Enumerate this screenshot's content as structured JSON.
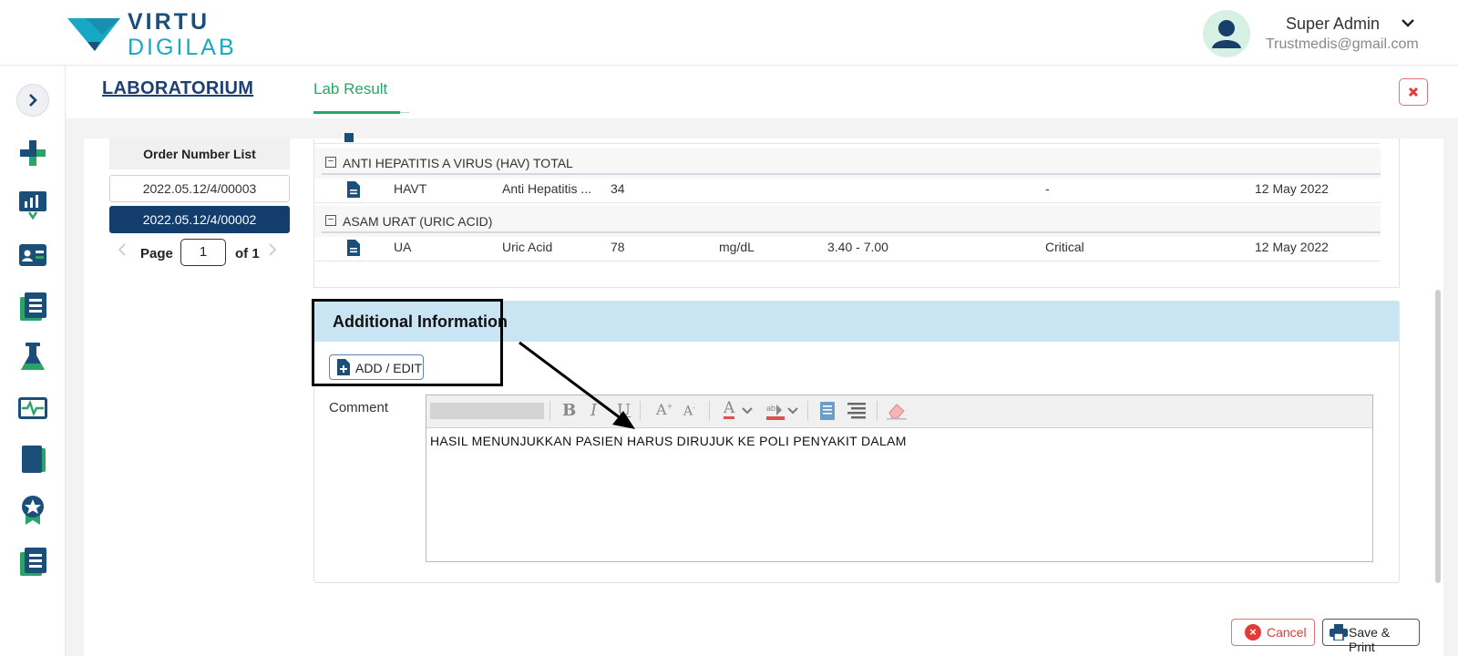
{
  "brand": {
    "line1": "VIRTU",
    "line2": "DIGILAB"
  },
  "user": {
    "name": "Super Admin",
    "email": "Trustmedis@gmail.com"
  },
  "sidebar": {
    "items": [
      {
        "icon": "chevron-right-icon"
      },
      {
        "icon": "medical-cross-icon"
      },
      {
        "icon": "chart-icon"
      },
      {
        "icon": "id-card-icon"
      },
      {
        "icon": "list-book-icon"
      },
      {
        "icon": "flask-icon"
      },
      {
        "icon": "monitor-pulse-icon"
      },
      {
        "icon": "book-icon"
      },
      {
        "icon": "award-icon"
      },
      {
        "icon": "list-book-icon"
      }
    ]
  },
  "page": {
    "title": "LABORATORIUM",
    "tabs": [
      {
        "label": "Lab Result",
        "active": true
      }
    ]
  },
  "orders": {
    "header": "Order Number List",
    "items": [
      {
        "number": "2022.05.12/4/00003",
        "active": false
      },
      {
        "number": "2022.05.12/4/00002",
        "active": true
      }
    ],
    "pager": {
      "page_label": "Page",
      "current": "1",
      "of_label": "of 1"
    }
  },
  "results": {
    "groups": [
      {
        "name": "ANTI HEPATITIS A VIRUS (HAV) TOTAL",
        "rows": [
          {
            "code": "HAVT",
            "name": "Anti Hepatitis ...",
            "value": "34",
            "unit": "",
            "range": "",
            "flag": "-",
            "date": "12 May 2022"
          }
        ]
      },
      {
        "name": "ASAM URAT (URIC ACID)",
        "rows": [
          {
            "code": "UA",
            "name": "Uric Acid",
            "value": "78",
            "unit": "mg/dL",
            "range": "3.40 - 7.00",
            "flag": "Critical",
            "date": "12 May 2022"
          }
        ]
      }
    ]
  },
  "additional": {
    "title": "Additional Information",
    "add_edit_label": "ADD / EDIT",
    "comment_label": "Comment",
    "comment_text": "HASIL MENUNJUKKAN PASIEN HARUS DIRUJUK KE POLI PENYAKIT DALAM",
    "toolbar": [
      "bold-icon",
      "italic-icon",
      "underline-icon",
      "font-grow-icon",
      "font-shrink-icon",
      "font-color-icon",
      "highlight-color-icon",
      "paragraph-icon",
      "align-icon",
      "eraser-icon"
    ]
  },
  "actions": {
    "cancel_label": "Cancel",
    "print_label": "Save & Print"
  },
  "colors": {
    "navy": "#133d6c",
    "green": "#2aa468",
    "teal": "#17a9c4",
    "header_blue": "#c9e4f3",
    "danger": "#e53935"
  }
}
